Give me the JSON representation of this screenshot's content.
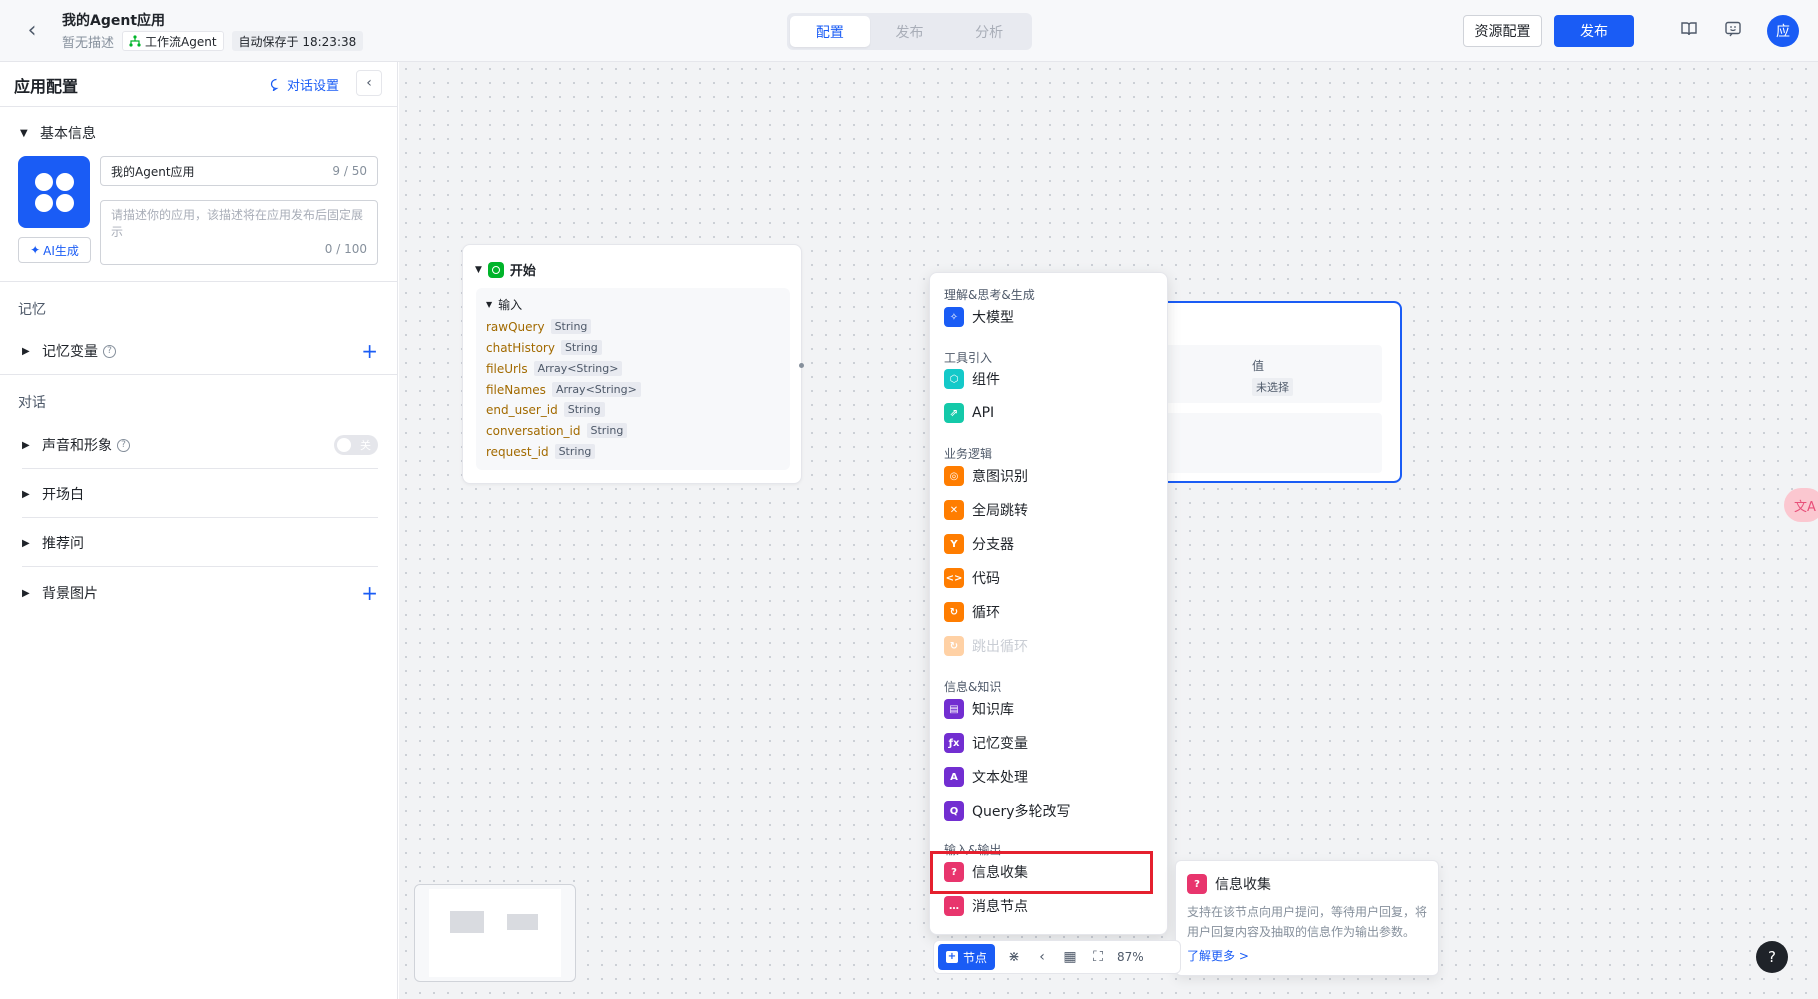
{
  "header": {
    "title": "我的Agent应用",
    "description": "暂无描述",
    "agent_type": "工作流Agent",
    "autosave": "自动保存于 18:23:38",
    "tabs": [
      {
        "label": "配置",
        "active": true
      },
      {
        "label": "发布",
        "active": false
      },
      {
        "label": "分析",
        "active": false
      }
    ],
    "resource_button": "资源配置",
    "publish_button": "发布",
    "avatar_letter": "应"
  },
  "left_panel": {
    "title": "应用配置",
    "chat_settings": "对话设置",
    "basic_info": {
      "label": "基本信息",
      "name_value": "我的Agent应用",
      "name_count": "9 / 50",
      "desc_placeholder": "请描述你的应用，该描述将在应用发布后固定展示",
      "desc_count": "0 / 100",
      "ai_generate": "AI生成"
    },
    "memory_group": "记忆",
    "memory_variable": "记忆变量",
    "dialog_group": "对话",
    "voice_avatar": "声音和形象",
    "voice_toggle": "关",
    "opening": "开场白",
    "recommend": "推荐问",
    "background": "背景图片"
  },
  "start_node": {
    "title": "开始",
    "input_label": "输入",
    "variables": [
      {
        "name": "rawQuery",
        "type": "String"
      },
      {
        "name": "chatHistory",
        "type": "String"
      },
      {
        "name": "fileUrls",
        "type": "Array<String>"
      },
      {
        "name": "fileNames",
        "type": "Array<String>"
      },
      {
        "name": "end_user_id",
        "type": "String"
      },
      {
        "name": "conversation_id",
        "type": "String"
      },
      {
        "name": "request_id",
        "type": "String"
      }
    ]
  },
  "selected_node": {
    "value_label": "值",
    "value": "未选择"
  },
  "node_menu": {
    "categories": [
      {
        "label": "理解&思考&生成",
        "items": [
          {
            "label": "大模型",
            "color": "#1a5cf5",
            "icon": "llm-icon"
          }
        ]
      },
      {
        "label": "工具引入",
        "items": [
          {
            "label": "组件",
            "color": "#14c9c9",
            "icon": "component-icon"
          },
          {
            "label": "API",
            "color": "#14c9a9",
            "icon": "api-icon"
          }
        ]
      },
      {
        "label": "业务逻辑",
        "items": [
          {
            "label": "意图识别",
            "color": "#ff7d00",
            "icon": "intent-icon"
          },
          {
            "label": "全局跳转",
            "color": "#ff7d00",
            "icon": "jump-icon"
          },
          {
            "label": "分支器",
            "color": "#ff7d00",
            "icon": "branch-icon"
          },
          {
            "label": "代码",
            "color": "#ff7d00",
            "icon": "code-icon"
          },
          {
            "label": "循环",
            "color": "#ff7d00",
            "icon": "loop-icon"
          },
          {
            "label": "跳出循环",
            "color": "#ff7d00",
            "icon": "break-loop-icon",
            "disabled": true
          }
        ]
      },
      {
        "label": "信息&知识",
        "items": [
          {
            "label": "知识库",
            "color": "#722ed1",
            "icon": "knowledge-icon"
          },
          {
            "label": "记忆变量",
            "color": "#722ed1",
            "icon": "memory-var-icon"
          },
          {
            "label": "文本处理",
            "color": "#722ed1",
            "icon": "text-process-icon"
          },
          {
            "label": "Query多轮改写",
            "color": "#722ed1",
            "icon": "query-rewrite-icon"
          }
        ]
      },
      {
        "label": "输入&输出",
        "items": [
          {
            "label": "信息收集",
            "color": "#e8356d",
            "icon": "info-collect-icon"
          },
          {
            "label": "消息节点",
            "color": "#e8356d",
            "icon": "message-icon"
          }
        ]
      }
    ]
  },
  "tooltip": {
    "title": "信息收集",
    "description": "支持在该节点向用户提问，等待用户回复，将用户回复内容及抽取的信息作为输出参数。",
    "learn_more": "了解更多 >"
  },
  "toolbar": {
    "node_button": "节点",
    "zoom": "87%"
  },
  "help": "?",
  "translate_float": "文A"
}
